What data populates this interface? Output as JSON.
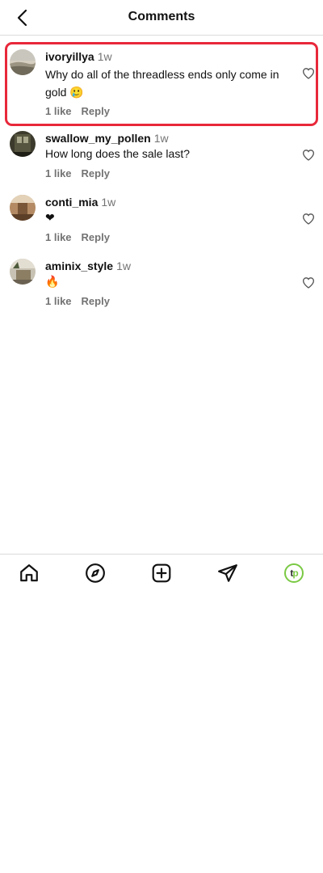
{
  "header": {
    "title": "Comments"
  },
  "comments": [
    {
      "username": "ivoryillya",
      "time": "1w",
      "text": "Why do all of the threadless ends only come in gold 🥲",
      "likes": "1 like",
      "reply": "Reply"
    },
    {
      "username": "swallow_my_pollen",
      "time": "1w",
      "text": "How long does the sale last?",
      "likes": "1 like",
      "reply": "Reply"
    },
    {
      "username": "conti_mia",
      "time": "1w",
      "text": "❤",
      "likes": "1 like",
      "reply": "Reply"
    },
    {
      "username": "aminix_style",
      "time": "1w",
      "text": "🔥",
      "likes": "1 like",
      "reply": "Reply"
    }
  ],
  "bottom_nav": {
    "items": [
      "home-icon",
      "explore-icon",
      "create-icon",
      "direct-messages-icon",
      "profile-icon"
    ],
    "logo_text_t": "t",
    "logo_text_p": "p"
  },
  "colors": {
    "highlight": "#e8283a",
    "muted_text": "#737373",
    "divider": "#dbdbdb",
    "logo_green": "#7ac943"
  }
}
